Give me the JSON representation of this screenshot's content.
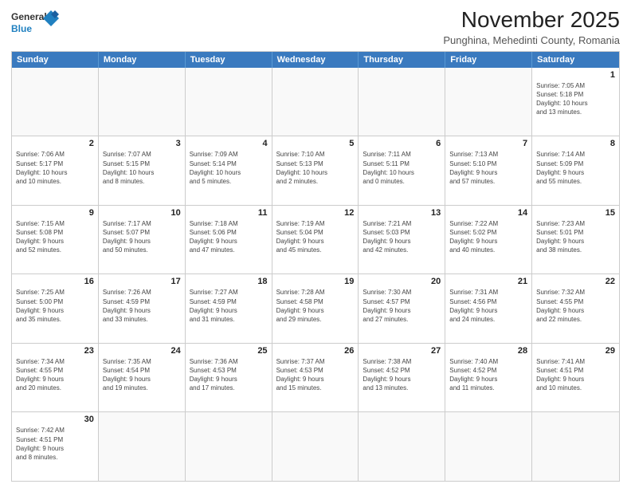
{
  "header": {
    "logo_line1": "General",
    "logo_line2": "Blue",
    "month_title": "November 2025",
    "subtitle": "Punghina, Mehedinti County, Romania"
  },
  "weekdays": [
    "Sunday",
    "Monday",
    "Tuesday",
    "Wednesday",
    "Thursday",
    "Friday",
    "Saturday"
  ],
  "rows": [
    [
      {
        "day": "",
        "info": ""
      },
      {
        "day": "",
        "info": ""
      },
      {
        "day": "",
        "info": ""
      },
      {
        "day": "",
        "info": ""
      },
      {
        "day": "",
        "info": ""
      },
      {
        "day": "",
        "info": ""
      },
      {
        "day": "1",
        "info": "Sunrise: 7:05 AM\nSunset: 5:18 PM\nDaylight: 10 hours\nand 13 minutes."
      }
    ],
    [
      {
        "day": "2",
        "info": "Sunrise: 7:06 AM\nSunset: 5:17 PM\nDaylight: 10 hours\nand 10 minutes."
      },
      {
        "day": "3",
        "info": "Sunrise: 7:07 AM\nSunset: 5:15 PM\nDaylight: 10 hours\nand 8 minutes."
      },
      {
        "day": "4",
        "info": "Sunrise: 7:09 AM\nSunset: 5:14 PM\nDaylight: 10 hours\nand 5 minutes."
      },
      {
        "day": "5",
        "info": "Sunrise: 7:10 AM\nSunset: 5:13 PM\nDaylight: 10 hours\nand 2 minutes."
      },
      {
        "day": "6",
        "info": "Sunrise: 7:11 AM\nSunset: 5:11 PM\nDaylight: 10 hours\nand 0 minutes."
      },
      {
        "day": "7",
        "info": "Sunrise: 7:13 AM\nSunset: 5:10 PM\nDaylight: 9 hours\nand 57 minutes."
      },
      {
        "day": "8",
        "info": "Sunrise: 7:14 AM\nSunset: 5:09 PM\nDaylight: 9 hours\nand 55 minutes."
      }
    ],
    [
      {
        "day": "9",
        "info": "Sunrise: 7:15 AM\nSunset: 5:08 PM\nDaylight: 9 hours\nand 52 minutes."
      },
      {
        "day": "10",
        "info": "Sunrise: 7:17 AM\nSunset: 5:07 PM\nDaylight: 9 hours\nand 50 minutes."
      },
      {
        "day": "11",
        "info": "Sunrise: 7:18 AM\nSunset: 5:06 PM\nDaylight: 9 hours\nand 47 minutes."
      },
      {
        "day": "12",
        "info": "Sunrise: 7:19 AM\nSunset: 5:04 PM\nDaylight: 9 hours\nand 45 minutes."
      },
      {
        "day": "13",
        "info": "Sunrise: 7:21 AM\nSunset: 5:03 PM\nDaylight: 9 hours\nand 42 minutes."
      },
      {
        "day": "14",
        "info": "Sunrise: 7:22 AM\nSunset: 5:02 PM\nDaylight: 9 hours\nand 40 minutes."
      },
      {
        "day": "15",
        "info": "Sunrise: 7:23 AM\nSunset: 5:01 PM\nDaylight: 9 hours\nand 38 minutes."
      }
    ],
    [
      {
        "day": "16",
        "info": "Sunrise: 7:25 AM\nSunset: 5:00 PM\nDaylight: 9 hours\nand 35 minutes."
      },
      {
        "day": "17",
        "info": "Sunrise: 7:26 AM\nSunset: 4:59 PM\nDaylight: 9 hours\nand 33 minutes."
      },
      {
        "day": "18",
        "info": "Sunrise: 7:27 AM\nSunset: 4:59 PM\nDaylight: 9 hours\nand 31 minutes."
      },
      {
        "day": "19",
        "info": "Sunrise: 7:28 AM\nSunset: 4:58 PM\nDaylight: 9 hours\nand 29 minutes."
      },
      {
        "day": "20",
        "info": "Sunrise: 7:30 AM\nSunset: 4:57 PM\nDaylight: 9 hours\nand 27 minutes."
      },
      {
        "day": "21",
        "info": "Sunrise: 7:31 AM\nSunset: 4:56 PM\nDaylight: 9 hours\nand 24 minutes."
      },
      {
        "day": "22",
        "info": "Sunrise: 7:32 AM\nSunset: 4:55 PM\nDaylight: 9 hours\nand 22 minutes."
      }
    ],
    [
      {
        "day": "23",
        "info": "Sunrise: 7:34 AM\nSunset: 4:55 PM\nDaylight: 9 hours\nand 20 minutes."
      },
      {
        "day": "24",
        "info": "Sunrise: 7:35 AM\nSunset: 4:54 PM\nDaylight: 9 hours\nand 19 minutes."
      },
      {
        "day": "25",
        "info": "Sunrise: 7:36 AM\nSunset: 4:53 PM\nDaylight: 9 hours\nand 17 minutes."
      },
      {
        "day": "26",
        "info": "Sunrise: 7:37 AM\nSunset: 4:53 PM\nDaylight: 9 hours\nand 15 minutes."
      },
      {
        "day": "27",
        "info": "Sunrise: 7:38 AM\nSunset: 4:52 PM\nDaylight: 9 hours\nand 13 minutes."
      },
      {
        "day": "28",
        "info": "Sunrise: 7:40 AM\nSunset: 4:52 PM\nDaylight: 9 hours\nand 11 minutes."
      },
      {
        "day": "29",
        "info": "Sunrise: 7:41 AM\nSunset: 4:51 PM\nDaylight: 9 hours\nand 10 minutes."
      }
    ],
    [
      {
        "day": "30",
        "info": "Sunrise: 7:42 AM\nSunset: 4:51 PM\nDaylight: 9 hours\nand 8 minutes."
      },
      {
        "day": "",
        "info": ""
      },
      {
        "day": "",
        "info": ""
      },
      {
        "day": "",
        "info": ""
      },
      {
        "day": "",
        "info": ""
      },
      {
        "day": "",
        "info": ""
      },
      {
        "day": "",
        "info": ""
      }
    ]
  ]
}
